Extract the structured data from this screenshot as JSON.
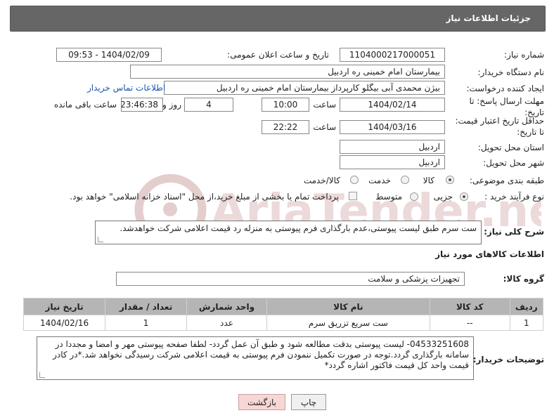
{
  "header": {
    "title": "جزئیات اطلاعات نیاز"
  },
  "fields": {
    "need_number_label": "شماره نیاز:",
    "need_number": "1104000217000051",
    "announce_label": "تاریخ و ساعت اعلان عمومی:",
    "announce_value": "1404/02/09 - 09:53",
    "buyer_label": "نام دستگاه خریدار:",
    "buyer_value": "بیمارستان امام خمینی  ره  اردبیل",
    "creator_label": "ایجاد کننده درخواست:",
    "creator_value": "بیژن محمدی آبی بیگلو کارپرداز بیمارستان امام خمینی  ره  اردبیل",
    "contact_link": "اطلاعات تماس خریدار",
    "deadline_label_1": "مهلت ارسال پاسخ: تا",
    "deadline_label_2": "تاریخ:",
    "deadline_date": "1404/02/14",
    "time_label": "ساعت",
    "deadline_time": "10:00",
    "days_value": "4",
    "days_label": "روز و",
    "remaining_value": "23:46:38",
    "remaining_label": "ساعت باقی مانده",
    "validity_label_1": "حداقل تاریخ اعتبار قیمت:",
    "validity_label_2": "تا تاریخ:",
    "validity_date": "1404/03/16",
    "validity_time": "22:22",
    "province_label": "استان محل تحویل:",
    "province_value": "اردبیل",
    "city_label": "شهر محل تحویل:",
    "city_value": "اردبیل",
    "category_label": "طبقه بندی موضوعی:",
    "category_options": [
      "کالا",
      "خدمت",
      "کالا/خدمت"
    ],
    "category_selected": "کالا",
    "process_label": "نوع فرآیند خرید :",
    "process_options": [
      "جزیی",
      "متوسط"
    ],
    "process_selected": "جزیی",
    "treasury_text": "پرداخت تمام یا بخشی از مبلغ خرید،از محل \"اسناد خزانه اسلامی\" خواهد بود."
  },
  "summary": {
    "label": "شرح کلی نیاز:",
    "text": "ست سرم طبق لیست پیوستی،عدم بارگذاری فرم پیوستی به منزله رد قیمت اعلامی شرکت خواهدشد."
  },
  "goods": {
    "section_title": "اطلاعات کالاهای مورد نیاز",
    "group_label": "گروه کالا:",
    "group_value": "تجهیزات پزشکی و سلامت",
    "columns": [
      "ردیف",
      "کد کالا",
      "نام کالا",
      "واحد شمارش",
      "تعداد / مقدار",
      "تاریخ نیاز"
    ],
    "rows": [
      [
        "1",
        "--",
        "ست سریع تزریق سرم",
        "عدد",
        "1",
        "1404/02/16"
      ]
    ]
  },
  "buyer_notes": {
    "label": "توضیحات خریدار:",
    "text": "04533251608- لیست پیوستی بدقت مطالعه شود و طبق آن عمل گردد- لطفا صفحه پیوستی مهر و امضا و مجددا در سامانه بارگذاری گردد.توجه در صورت تکمیل ننمودن فرم پیوستی به قیمت اعلامی شرکت رسیدگی نخواهد شد.*در کادر قیمت واحد کل قیمت فاکتور اشاره گردد*"
  },
  "buttons": {
    "print": "چاپ",
    "back": "بازگشت"
  },
  "watermark": {
    "text": "AriaTender.neT"
  },
  "colors": {
    "header_bg": "#666666",
    "table_head_bg": "#b5b5b5",
    "link": "#1a55b0",
    "back_btn": "#f7d6d6",
    "watermark": "#d9c0c0"
  }
}
